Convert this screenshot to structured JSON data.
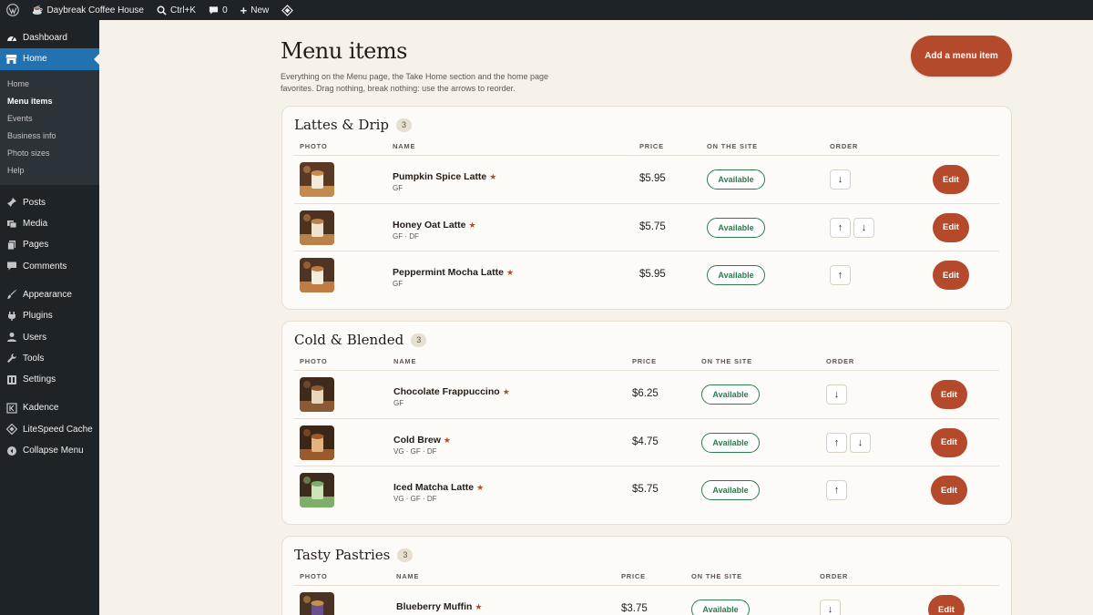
{
  "adminbar": {
    "site_name": "Daybreak Coffee House",
    "search_shortcut": "Ctrl+K",
    "comments_count": "0",
    "new_label": "New"
  },
  "sidebar": {
    "items_top": [
      {
        "label": "Dashboard",
        "icon": "dashboard-icon"
      },
      {
        "label": "Home",
        "icon": "storefront-icon",
        "current": true
      }
    ],
    "submenu": [
      "Home",
      "Menu items",
      "Events",
      "Business info",
      "Photo sizes",
      "Help"
    ],
    "submenu_current": "Menu items",
    "items_group1": [
      {
        "label": "Posts",
        "icon": "pin-icon"
      },
      {
        "label": "Media",
        "icon": "media-icon"
      },
      {
        "label": "Pages",
        "icon": "pages-icon"
      },
      {
        "label": "Comments",
        "icon": "comment-icon"
      }
    ],
    "items_group2": [
      {
        "label": "Appearance",
        "icon": "brush-icon"
      },
      {
        "label": "Plugins",
        "icon": "plug-icon"
      },
      {
        "label": "Users",
        "icon": "user-icon"
      },
      {
        "label": "Tools",
        "icon": "wrench-icon"
      },
      {
        "label": "Settings",
        "icon": "settings-icon"
      }
    ],
    "items_group3": [
      {
        "label": "Kadence",
        "icon": "kadence-icon"
      },
      {
        "label": "LiteSpeed Cache",
        "icon": "diamond-icon"
      },
      {
        "label": "Collapse Menu",
        "icon": "collapse-icon"
      }
    ]
  },
  "page": {
    "title": "Menu items",
    "description": "Everything on the Menu page, the Take Home section and the home page favorites. Drag nothing, break nothing: use the arrows to reorder.",
    "add_button": "Add a menu item"
  },
  "columns": {
    "photo": "PHOTO",
    "name": "NAME",
    "price": "PRICE",
    "on_site": "ON THE SITE",
    "order": "ORDER"
  },
  "status_label": "Available",
  "edit_label": "Edit",
  "arrows": {
    "up": "↑",
    "down": "↓"
  },
  "star": "★",
  "colors": {
    "accent": "#b4492c",
    "available": "#2d7a4c",
    "background": "#f6f2ea",
    "admin_blue": "#2271b1"
  },
  "sections": [
    {
      "title": "Lattes & Drip",
      "count": "3",
      "items": [
        {
          "name": "Pumpkin Spice Latte",
          "diet": "GF",
          "price": "$5.95",
          "up": false,
          "down": true
        },
        {
          "name": "Honey Oat Latte",
          "diet": "GF · DF",
          "price": "$5.75",
          "up": true,
          "down": true
        },
        {
          "name": "Peppermint Mocha Latte",
          "diet": "GF",
          "price": "$5.95",
          "up": true,
          "down": false
        }
      ]
    },
    {
      "title": "Cold & Blended",
      "count": "3",
      "items": [
        {
          "name": "Chocolate Frappuccino",
          "diet": "GF",
          "price": "$6.25",
          "up": false,
          "down": true
        },
        {
          "name": "Cold Brew",
          "diet": "VG · GF · DF",
          "price": "$4.75",
          "up": true,
          "down": true
        },
        {
          "name": "Iced Matcha Latte",
          "diet": "VG · GF · DF",
          "price": "$5.75",
          "up": true,
          "down": false
        }
      ]
    },
    {
      "title": "Tasty Pastries",
      "count": "3",
      "items": [
        {
          "name": "Blueberry Muffin",
          "diet": "",
          "price": "$3.75",
          "up": false,
          "down": true
        }
      ]
    }
  ]
}
